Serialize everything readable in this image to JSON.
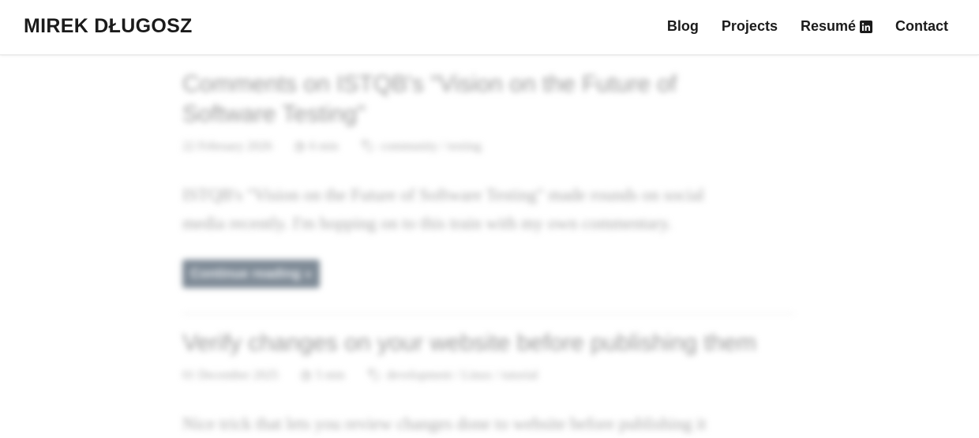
{
  "header": {
    "site_title": "MIREK DŁUGOSZ",
    "nav": [
      {
        "label": "Blog"
      },
      {
        "label": "Projects"
      },
      {
        "label": "Resumé",
        "icon": "linkedin-icon"
      },
      {
        "label": "Contact"
      }
    ]
  },
  "posts": [
    {
      "title_line1": "Comments on ISTQB's \"Vision on the Future of",
      "title_line2": "Software Testing\"",
      "date": "22 February 2026",
      "read_time": "6 min",
      "tags": "community / testing",
      "excerpt_line1": "ISTQB's \"Vision on the Future of Software Testing\" made rounds on social",
      "excerpt_line2": "media recently. I'm hopping on to this train with my own commentary.",
      "button_label": "Continue reading »"
    },
    {
      "title_line1": "Verify changes on your website before publishing them",
      "date": "01 December 2025",
      "read_time": "5 min",
      "tags": "development / Linux / tutorial",
      "excerpt_line1": "Nice trick that lets you review changes done to website before publishing it"
    }
  ],
  "colors": {
    "text_dark": "#1b1b1b",
    "button_bg": "#7e8a96"
  }
}
